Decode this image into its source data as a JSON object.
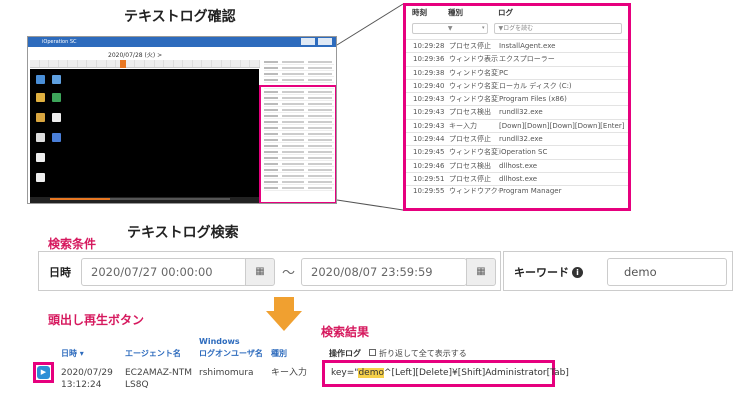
{
  "titles": {
    "text_log_confirm": "テキストログ確認",
    "text_log_search": "テキストログ検索"
  },
  "annotations": {
    "search_conditions": "検索条件",
    "cue_play_button": "頭出し再生ボタン",
    "search_results": "検索結果"
  },
  "app": {
    "title": "iOperation SC",
    "date": "2020/07/28 (火)  >"
  },
  "zoom": {
    "headers": {
      "time": "時刻",
      "kind": "種別",
      "log": "ログ"
    },
    "filter_kind": "▼",
    "filter_log": "▼ログを読む",
    "rows": [
      {
        "time": "10:29:28",
        "kind": "プロセス停止",
        "log": "InstallAgent.exe"
      },
      {
        "time": "10:29:36",
        "kind": "ウィンドウ表示",
        "log": "エクスプローラー"
      },
      {
        "time": "10:29:38",
        "kind": "ウィンドウ名変更",
        "log": "PC"
      },
      {
        "time": "10:29:40",
        "kind": "ウィンドウ名変更",
        "log": "ローカル ディスク (C:)"
      },
      {
        "time": "10:29:43",
        "kind": "ウィンドウ名変更",
        "log": "Program Files (x86)"
      },
      {
        "time": "10:29:43",
        "kind": "プロセス検出",
        "log": "rundll32.exe"
      },
      {
        "time": "10:29:43",
        "kind": "キー入力",
        "log": "[Down][Down][Down][Down][Enter]"
      },
      {
        "time": "10:29:44",
        "kind": "プロセス停止",
        "log": "rundll32.exe"
      },
      {
        "time": "10:29:45",
        "kind": "ウィンドウ名変更",
        "log": "iOperation SC"
      },
      {
        "time": "10:29:46",
        "kind": "プロセス検出",
        "log": "dllhost.exe"
      },
      {
        "time": "10:29:51",
        "kind": "プロセス停止",
        "log": "dllhost.exe"
      },
      {
        "time": "10:29:55",
        "kind": "ウィンドウアクティブ",
        "log": "Program Manager"
      }
    ]
  },
  "search": {
    "date_label": "日時",
    "from": "2020/07/27 00:00:00",
    "to": "2020/08/07 23:59:59",
    "tilde": "〜",
    "keyword_label": "キーワード",
    "keyword_value": "demo"
  },
  "results": {
    "headers": {
      "datetime": "日時 ▾",
      "agent": "エージェント名",
      "windows_user_1": "Windows",
      "windows_user_2": "ログオンユーザ名",
      "kind": "種別",
      "oplog": "操作ログ",
      "wrap_toggle": "折り返して全て表示する"
    },
    "row": {
      "date": "2020/07/29",
      "time": "13:12:24",
      "agent_1": "EC2AMAZ-NTM",
      "agent_2": "LS8Q",
      "user": "rshimomura",
      "kind": "キー入力",
      "log_prefix": "key=\"",
      "log_highlight": "demo",
      "log_suffix": "^[Left][Delete]¥[Shift]Administrator[Tab]"
    }
  },
  "colors": {
    "accent": "#e6007e",
    "brand_blue": "#2d6bbd",
    "arrow_orange": "#f0a030",
    "highlight": "#f5d04a"
  }
}
